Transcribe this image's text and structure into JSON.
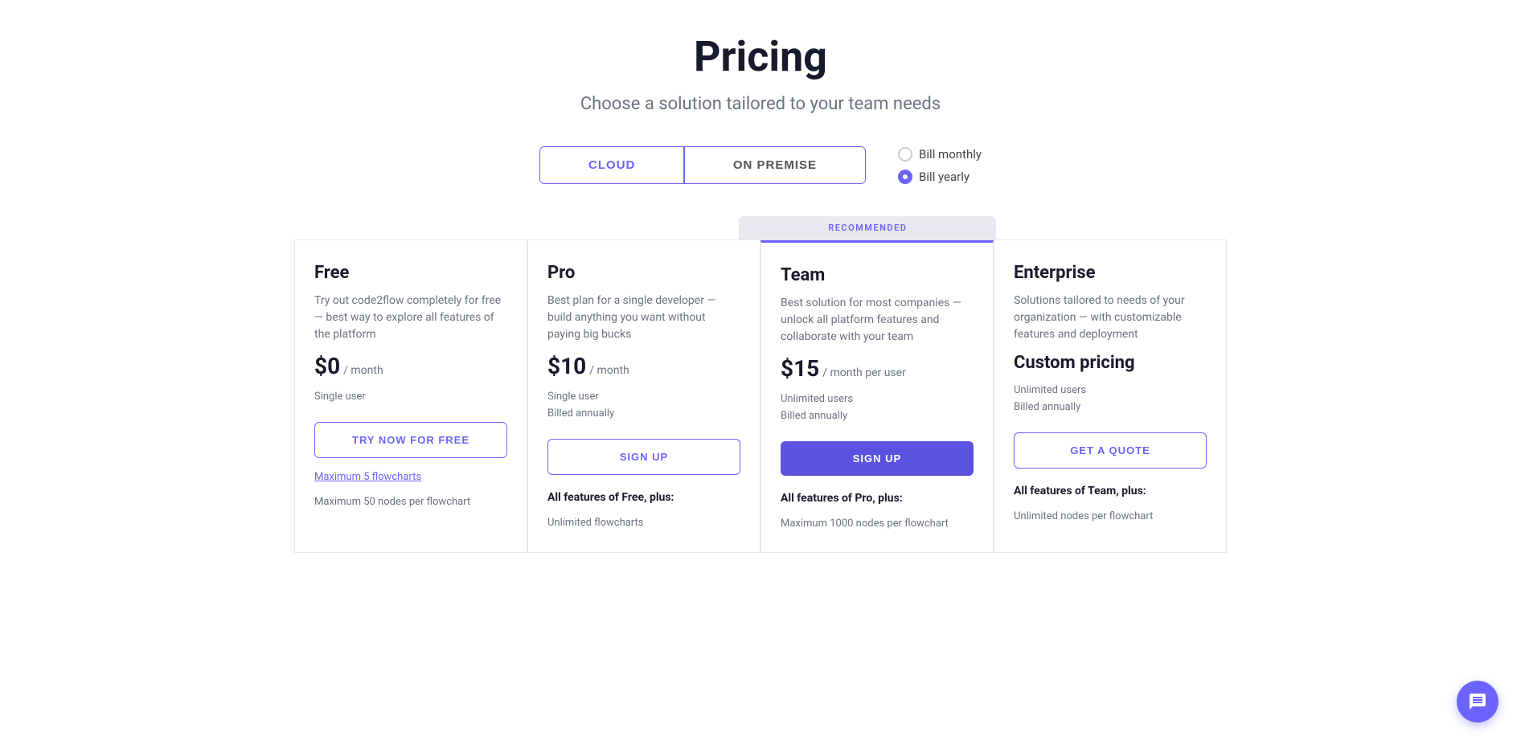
{
  "page": {
    "title": "Pricing",
    "subtitle": "Choose a solution tailored to your team needs"
  },
  "toggle": {
    "options": [
      "CLOUD",
      "ON PREMISE"
    ],
    "active": "CLOUD"
  },
  "billing": {
    "options": [
      {
        "label": "Bill monthly",
        "checked": false
      },
      {
        "label": "Bill yearly",
        "checked": true
      }
    ]
  },
  "recommended_label": "RECOMMENDED",
  "plans": [
    {
      "id": "free",
      "name": "Free",
      "description": "Try out code2flow completely for free — best way to explore all features of the platform",
      "price_amount": "$0",
      "price_period": "/ month",
      "price_custom": null,
      "user_line1": "Single user",
      "user_line2": null,
      "cta_label": "TRY NOW FOR FREE",
      "cta_type": "outline",
      "features_header": null,
      "features": [
        {
          "text": "Maximum 5 flowcharts",
          "highlight": true
        },
        {
          "text": "Maximum 50 nodes per flowchart",
          "highlight": false
        }
      ],
      "recommended": false
    },
    {
      "id": "pro",
      "name": "Pro",
      "description": "Best plan for a single developer — build anything you want without paying big bucks",
      "price_amount": "$10",
      "price_period": "/ month",
      "price_custom": null,
      "user_line1": "Single user",
      "user_line2": "Billed annually",
      "cta_label": "SIGN UP",
      "cta_type": "outline",
      "features_header": "All features of Free, plus:",
      "features": [
        {
          "text": "Unlimited flowcharts",
          "highlight": false
        }
      ],
      "recommended": false
    },
    {
      "id": "team",
      "name": "Team",
      "description": "Best solution for most companies — unlock all platform features and collaborate with your team",
      "price_amount": "$15",
      "price_period": "/ month per user",
      "price_custom": null,
      "user_line1": "Unlimited users",
      "user_line2": "Billed annually",
      "cta_label": "SIGN UP",
      "cta_type": "filled",
      "features_header": "All features of Pro, plus:",
      "features": [
        {
          "text": "Maximum 1000 nodes per flowchart",
          "highlight": false
        }
      ],
      "recommended": true
    },
    {
      "id": "enterprise",
      "name": "Enterprise",
      "description": "Solutions tailored to needs of your organization — with customizable features and deployment",
      "price_amount": null,
      "price_period": null,
      "price_custom": "Custom pricing",
      "user_line1": "Unlimited users",
      "user_line2": "Billed annually",
      "cta_label": "GET A QUOTE",
      "cta_type": "outline",
      "features_header": "All features of Team, plus:",
      "features": [
        {
          "text": "Unlimited nodes per flowchart",
          "highlight": false
        }
      ],
      "recommended": false
    }
  ]
}
